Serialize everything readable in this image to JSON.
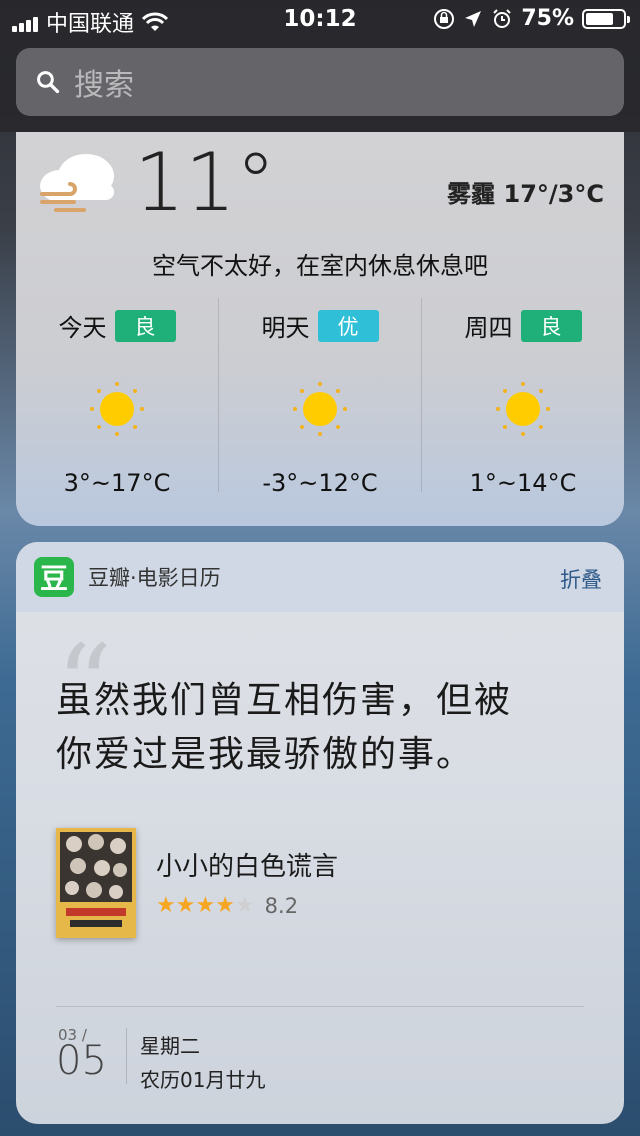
{
  "status_bar": {
    "carrier": "中国联通",
    "time": "10:12",
    "battery": "75%",
    "battery_level": 0.75
  },
  "search": {
    "placeholder": "搜索"
  },
  "weather": {
    "current_temp": "11°",
    "condition_summary": "雾霾 17°/3°C",
    "message": "空气不太好，在室内休息休息吧",
    "days": [
      {
        "name": "今天",
        "aqi": "良",
        "aqi_color": "#1fb07a",
        "range": "3°~17°C"
      },
      {
        "name": "明天",
        "aqi": "优",
        "aqi_color": "#2fbfd6",
        "range": "-3°~12°C"
      },
      {
        "name": "周四",
        "aqi": "良",
        "aqi_color": "#1fb07a",
        "range": "1°~14°C"
      }
    ]
  },
  "douban": {
    "logo_text": "豆",
    "title": "豆瓣·电影日历",
    "collapse_label": "折叠",
    "quote_line1": "虽然我们曾互相伤害，但被",
    "quote_line2": "你爱过是我最骄傲的事。",
    "movie_title": "小小的白色谎言",
    "rating": "8.2",
    "stars_filled": 4,
    "stars_total": 5,
    "month": "03 /",
    "day": "05",
    "weekday": "星期二",
    "lunar": "农历01月廿九"
  },
  "colors": {
    "accent_green": "#2ab64a",
    "star": "#f5a623",
    "link": "#2f5a8a"
  }
}
